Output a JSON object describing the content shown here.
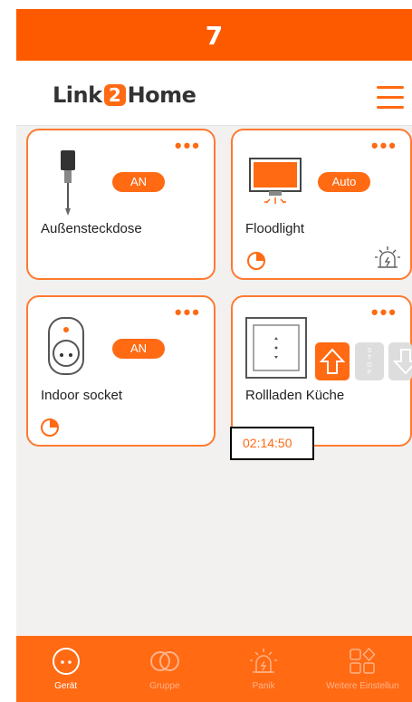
{
  "status_bar": {
    "number": "7"
  },
  "header": {
    "logo_left": "Link",
    "logo_mid": "2",
    "logo_right": "Home",
    "menu_icon": "hamburger-menu-icon"
  },
  "devices": [
    {
      "name": "Außensteckdose",
      "state": "AN",
      "icon": "outdoor-plug-icon"
    },
    {
      "name": "Floodlight",
      "state": "Auto",
      "icon": "floodlight-icon",
      "extra_icon": "alarm-light-icon",
      "has_timer": true
    },
    {
      "name": "Indoor socket",
      "state": "AN",
      "icon": "indoor-socket-icon",
      "has_timer": true
    },
    {
      "name": "Rollladen Küche",
      "icon": "shutter-switch-icon",
      "controls": {
        "up": "up-arrow-icon",
        "stop": "STOP",
        "down": "down-arrow-icon"
      },
      "timer": "02:14:50"
    }
  ],
  "nav": [
    {
      "label": "Gerät",
      "icon": "device-icon",
      "active": true
    },
    {
      "label": "Gruppe",
      "icon": "group-icon",
      "active": false
    },
    {
      "label": "Panik",
      "icon": "panic-icon",
      "active": false
    },
    {
      "label": "Weitere Einstellun",
      "icon": "settings-grid-icon",
      "active": false
    }
  ],
  "colors": {
    "accent": "#ff6a13",
    "status": "#fd5a00",
    "background": "#f2f1f0"
  }
}
